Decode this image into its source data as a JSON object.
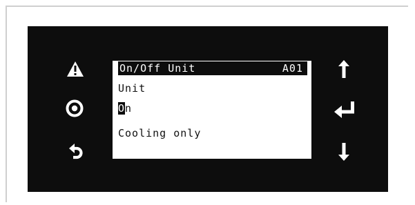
{
  "display": {
    "title": "On/Off Unit",
    "code": "A01",
    "line1": "Unit",
    "value_cursor_char": "O",
    "value_rest": "n",
    "line3": "Cooling only"
  },
  "icons": {
    "left": [
      "alarm-warning-icon",
      "program-circle-icon",
      "escape-back-icon"
    ],
    "right": [
      "up-arrow-icon",
      "enter-icon",
      "down-arrow-icon"
    ]
  },
  "colors": {
    "panel": "#0d0d0d",
    "screen": "#ffffff",
    "frame": "#cfcfcf"
  }
}
